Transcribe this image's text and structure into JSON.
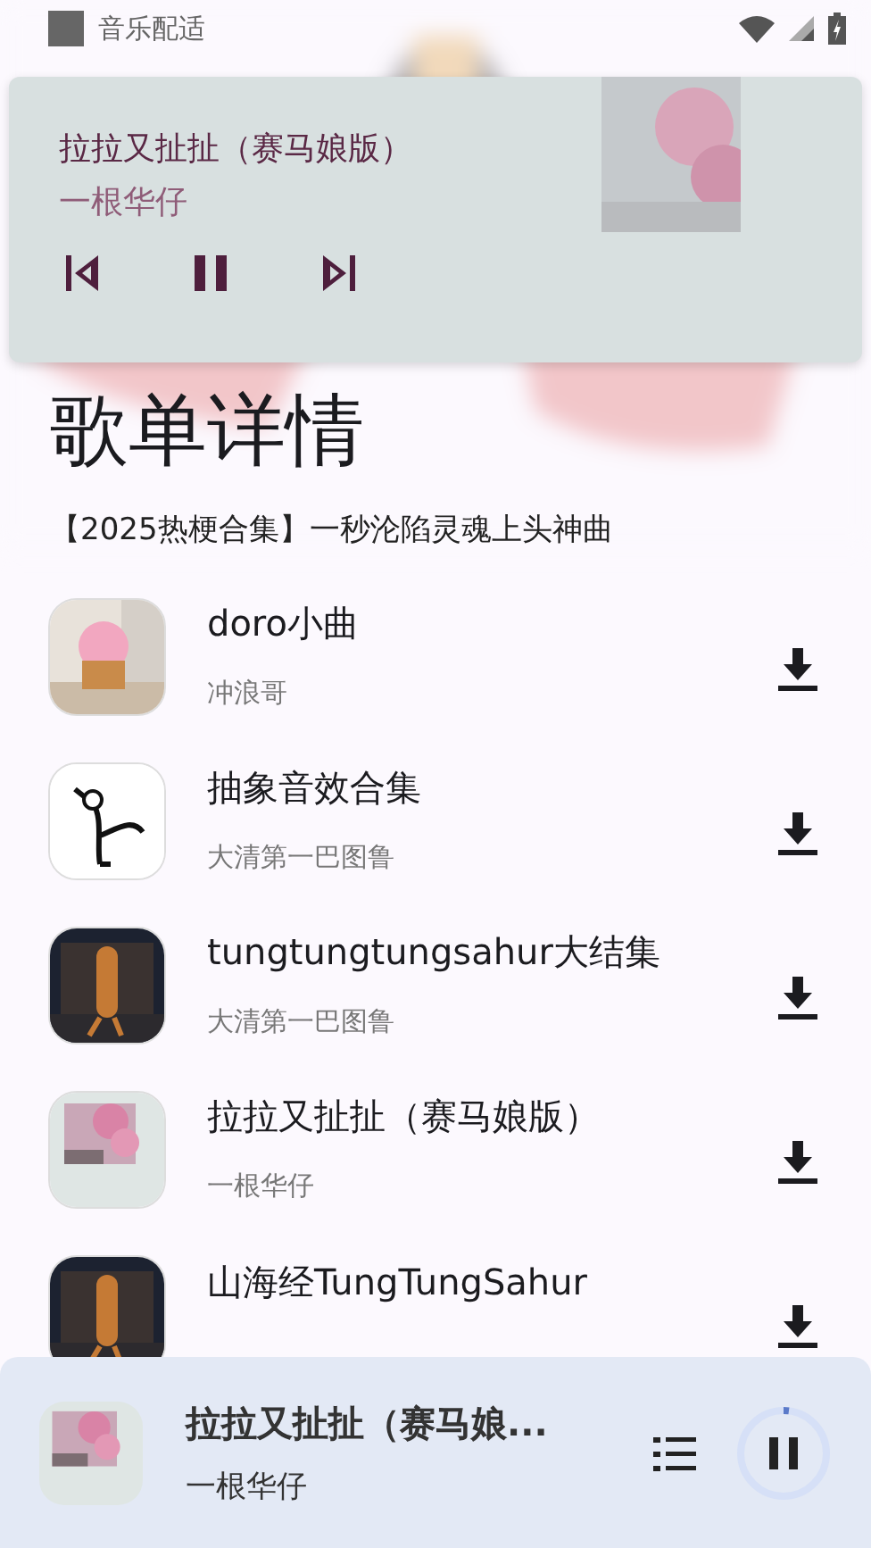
{
  "status_bar": {
    "app_label": "音乐配适"
  },
  "notification": {
    "title": "拉拉又扯扯（赛马娘版）",
    "artist": "一根华仔",
    "playing": true
  },
  "header": {
    "title": "歌单详情",
    "subtitle": "【2025热梗合集】一秒沦陷灵魂上头神曲"
  },
  "songs": [
    {
      "title": "doro小曲",
      "artist": "冲浪哥"
    },
    {
      "title": "抽象音效合集",
      "artist": "大清第一巴图鲁"
    },
    {
      "title": "tungtungtungsahur大结集",
      "artist": "大清第一巴图鲁"
    },
    {
      "title": "拉拉又扯扯（赛马娘版）",
      "artist": "一根华仔"
    },
    {
      "title": "山海经TungTungSahur"
    }
  ],
  "now_playing": {
    "title": "拉拉又扯扯（赛马娘...",
    "artist": "一根华仔",
    "playing": true,
    "level": 0.02
  }
}
